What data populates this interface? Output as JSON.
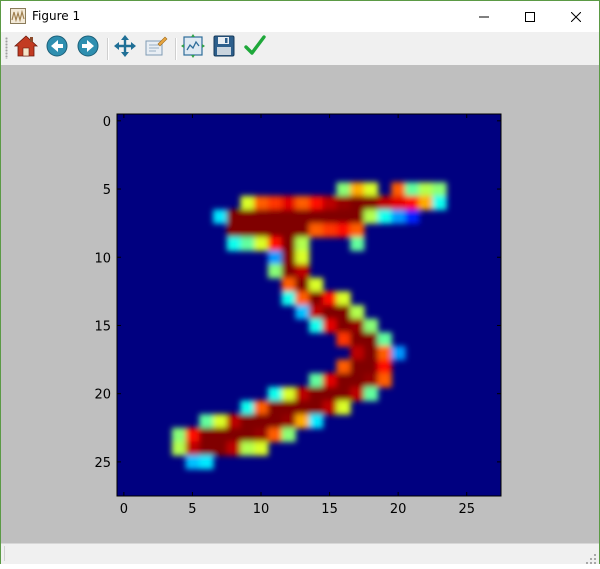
{
  "window": {
    "title": "Figure 1",
    "controls": {
      "minimize": "minimize-icon",
      "maximize": "maximize-icon",
      "close": "close-icon"
    }
  },
  "toolbar": {
    "buttons": [
      {
        "name": "home",
        "icon": "home-icon"
      },
      {
        "name": "back",
        "icon": "back-arrow-icon"
      },
      {
        "name": "forward",
        "icon": "forward-arrow-icon"
      },
      {
        "name": "pan",
        "icon": "pan-move-icon"
      },
      {
        "name": "zoom",
        "icon": "zoom-rect-icon"
      },
      {
        "name": "subplots",
        "icon": "configure-subplots-icon"
      },
      {
        "name": "save",
        "icon": "save-disk-icon"
      },
      {
        "name": "edit",
        "icon": "checkmark-icon"
      }
    ]
  },
  "colors": {
    "plot_background": "#00007f",
    "canvas_background": "#bfbfbf",
    "window_border": "#5b9a45"
  },
  "chart_data": {
    "type": "heatmap",
    "colormap": "jet",
    "value_range": [
      0,
      255
    ],
    "shape": [
      28,
      28
    ],
    "title": "",
    "xlabel": "",
    "ylabel": "",
    "xlim": [
      -0.5,
      27.5
    ],
    "ylim": [
      27.5,
      -0.5
    ],
    "x_ticks": [
      "0",
      "5",
      "10",
      "15",
      "20",
      "25"
    ],
    "y_ticks": [
      "0",
      "5",
      "10",
      "15",
      "20",
      "25"
    ],
    "nonzero_pixels": [
      [
        5,
        16,
        130
      ],
      [
        5,
        17,
        180
      ],
      [
        5,
        18,
        150
      ],
      [
        5,
        20,
        200
      ],
      [
        5,
        21,
        120
      ],
      [
        5,
        22,
        140
      ],
      [
        5,
        23,
        130
      ],
      [
        6,
        9,
        150
      ],
      [
        6,
        10,
        200
      ],
      [
        6,
        11,
        210
      ],
      [
        6,
        12,
        230
      ],
      [
        6,
        13,
        200
      ],
      [
        6,
        14,
        220
      ],
      [
        6,
        15,
        240
      ],
      [
        6,
        16,
        250
      ],
      [
        6,
        17,
        255
      ],
      [
        6,
        18,
        255
      ],
      [
        6,
        19,
        240
      ],
      [
        6,
        20,
        230
      ],
      [
        6,
        21,
        220
      ],
      [
        6,
        22,
        180
      ],
      [
        6,
        23,
        100
      ],
      [
        7,
        7,
        90
      ],
      [
        7,
        8,
        255
      ],
      [
        7,
        9,
        255
      ],
      [
        7,
        10,
        255
      ],
      [
        7,
        11,
        255
      ],
      [
        7,
        12,
        255
      ],
      [
        7,
        13,
        255
      ],
      [
        7,
        14,
        255
      ],
      [
        7,
        15,
        255
      ],
      [
        7,
        16,
        255
      ],
      [
        7,
        17,
        255
      ],
      [
        7,
        18,
        140
      ],
      [
        7,
        19,
        100
      ],
      [
        7,
        20,
        70
      ],
      [
        7,
        21,
        40
      ],
      [
        8,
        8,
        255
      ],
      [
        8,
        9,
        255
      ],
      [
        8,
        10,
        255
      ],
      [
        8,
        11,
        255
      ],
      [
        8,
        12,
        255
      ],
      [
        8,
        13,
        255
      ],
      [
        8,
        14,
        200
      ],
      [
        8,
        15,
        210
      ],
      [
        8,
        16,
        220
      ],
      [
        8,
        17,
        200
      ],
      [
        9,
        8,
        100
      ],
      [
        9,
        9,
        120
      ],
      [
        9,
        10,
        150
      ],
      [
        9,
        11,
        220
      ],
      [
        9,
        12,
        255
      ],
      [
        9,
        13,
        140
      ],
      [
        9,
        17,
        120
      ],
      [
        10,
        11,
        70
      ],
      [
        10,
        12,
        255
      ],
      [
        10,
        13,
        150
      ],
      [
        11,
        11,
        130
      ],
      [
        11,
        12,
        255
      ],
      [
        11,
        13,
        240
      ],
      [
        12,
        12,
        200
      ],
      [
        12,
        13,
        255
      ],
      [
        12,
        14,
        150
      ],
      [
        13,
        12,
        100
      ],
      [
        13,
        13,
        200
      ],
      [
        13,
        14,
        255
      ],
      [
        13,
        15,
        220
      ],
      [
        13,
        16,
        150
      ],
      [
        14,
        13,
        80
      ],
      [
        14,
        14,
        240
      ],
      [
        14,
        15,
        255
      ],
      [
        14,
        16,
        255
      ],
      [
        14,
        17,
        140
      ],
      [
        15,
        14,
        100
      ],
      [
        15,
        15,
        230
      ],
      [
        15,
        16,
        255
      ],
      [
        15,
        17,
        250
      ],
      [
        15,
        18,
        130
      ],
      [
        16,
        16,
        210
      ],
      [
        16,
        17,
        255
      ],
      [
        16,
        18,
        255
      ],
      [
        16,
        19,
        120
      ],
      [
        17,
        17,
        240
      ],
      [
        17,
        18,
        255
      ],
      [
        17,
        19,
        200
      ],
      [
        17,
        20,
        70
      ],
      [
        18,
        16,
        200
      ],
      [
        18,
        17,
        255
      ],
      [
        18,
        18,
        255
      ],
      [
        18,
        19,
        220
      ],
      [
        19,
        14,
        120
      ],
      [
        19,
        15,
        230
      ],
      [
        19,
        16,
        255
      ],
      [
        19,
        17,
        255
      ],
      [
        19,
        18,
        250
      ],
      [
        19,
        19,
        200
      ],
      [
        20,
        11,
        100
      ],
      [
        20,
        12,
        150
      ],
      [
        20,
        13,
        240
      ],
      [
        20,
        14,
        255
      ],
      [
        20,
        15,
        255
      ],
      [
        20,
        16,
        255
      ],
      [
        20,
        17,
        240
      ],
      [
        20,
        18,
        120
      ],
      [
        21,
        9,
        100
      ],
      [
        21,
        10,
        200
      ],
      [
        21,
        11,
        255
      ],
      [
        21,
        12,
        255
      ],
      [
        21,
        13,
        255
      ],
      [
        21,
        14,
        255
      ],
      [
        21,
        15,
        240
      ],
      [
        21,
        16,
        150
      ],
      [
        22,
        6,
        120
      ],
      [
        22,
        7,
        150
      ],
      [
        22,
        8,
        240
      ],
      [
        22,
        9,
        255
      ],
      [
        22,
        10,
        255
      ],
      [
        22,
        11,
        255
      ],
      [
        22,
        12,
        250
      ],
      [
        22,
        13,
        180
      ],
      [
        22,
        14,
        90
      ],
      [
        23,
        4,
        130
      ],
      [
        23,
        5,
        220
      ],
      [
        23,
        6,
        255
      ],
      [
        23,
        7,
        255
      ],
      [
        23,
        8,
        255
      ],
      [
        23,
        9,
        255
      ],
      [
        23,
        10,
        250
      ],
      [
        23,
        11,
        200
      ],
      [
        23,
        12,
        130
      ],
      [
        24,
        4,
        140
      ],
      [
        24,
        5,
        240
      ],
      [
        24,
        6,
        255
      ],
      [
        24,
        7,
        255
      ],
      [
        24,
        8,
        240
      ],
      [
        24,
        9,
        140
      ],
      [
        24,
        10,
        150
      ],
      [
        25,
        5,
        80
      ],
      [
        25,
        6,
        90
      ]
    ]
  }
}
